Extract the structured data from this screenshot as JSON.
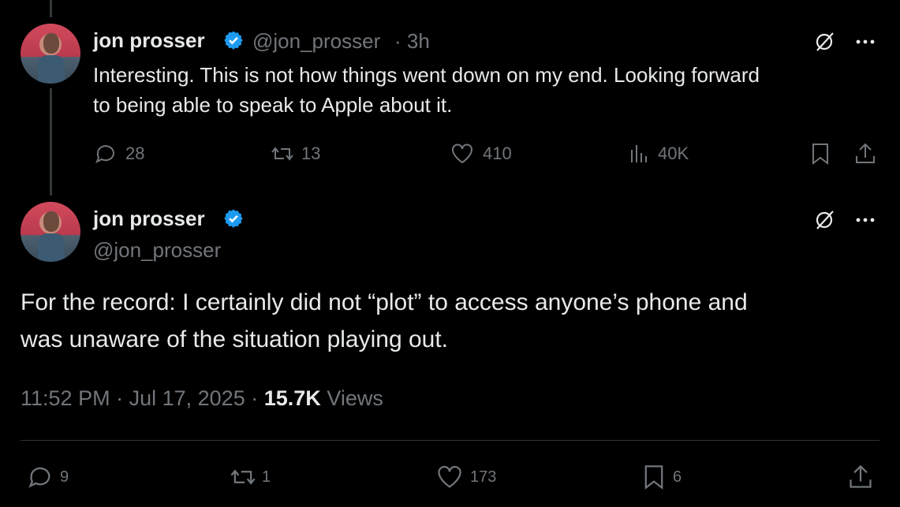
{
  "tweet1": {
    "author_name": "jon prosser",
    "handle": "@jon_prosser",
    "time": "· 3h",
    "text_line1": "Interesting. This is not how things went down on my end. Looking forward",
    "text_line2": "to being able to speak to Apple about it.",
    "replies": "28",
    "reposts": "13",
    "likes": "410",
    "views": "40K"
  },
  "tweet2": {
    "author_name": "jon prosser",
    "handle": "@jon_prosser",
    "text_line1": "For the record: I certainly did not “plot” to access anyone’s phone and",
    "text_line2": "was unaware of the situation playing out.",
    "time": "11:52 PM",
    "date": "Jul 17, 2025",
    "views_count": "15.7K",
    "views_label": "Views",
    "replies": "9",
    "reposts": "1",
    "likes": "173",
    "bookmarks": "6"
  },
  "colors": {
    "verified": "#1d9bf0",
    "muted": "#71767b",
    "text": "#e7e9ea"
  }
}
